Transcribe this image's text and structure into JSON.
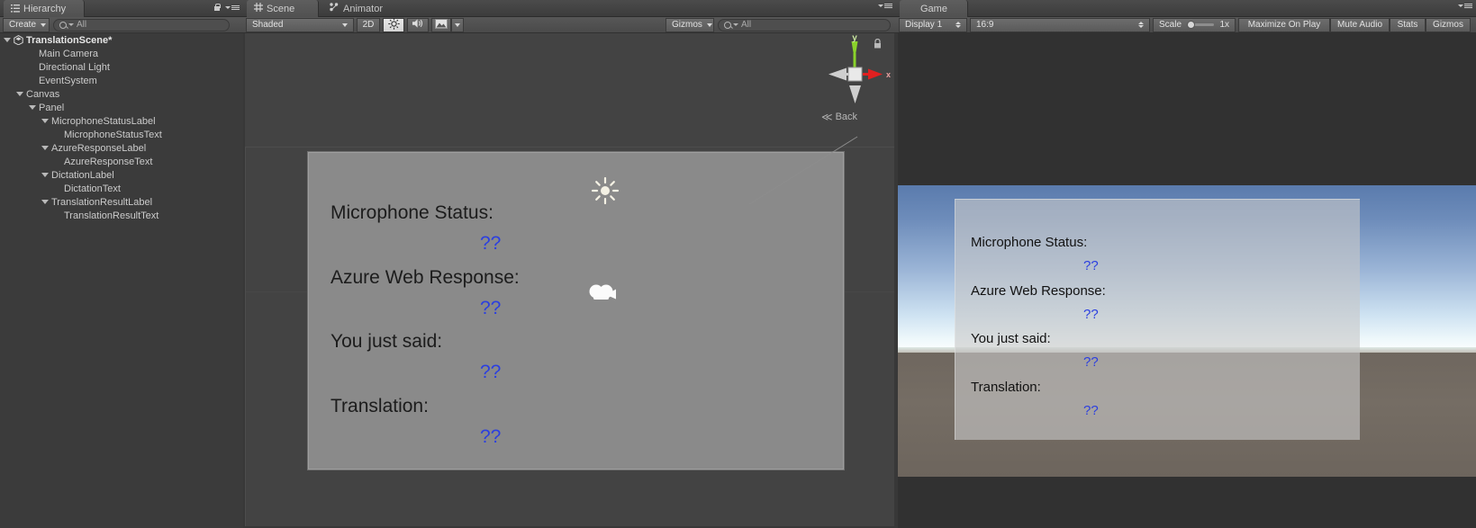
{
  "hierarchy": {
    "tab_label": "Hierarchy",
    "tab_icon": "hierarchy-icon",
    "create_label": "Create",
    "search_placeholder": "All",
    "search_value": "",
    "lock_icon": "lock-icon",
    "menu_icon": "panel-menu-icon",
    "tree": [
      {
        "label": "TranslationScene*",
        "depth": 0,
        "expanded": true,
        "root": true,
        "icon": "unity-scene-icon"
      },
      {
        "label": "Main Camera",
        "depth": 2,
        "expanded": false,
        "root": false
      },
      {
        "label": "Directional Light",
        "depth": 2,
        "expanded": false,
        "root": false
      },
      {
        "label": "EventSystem",
        "depth": 2,
        "expanded": false,
        "root": false
      },
      {
        "label": "Canvas",
        "depth": 1,
        "expanded": true,
        "root": false
      },
      {
        "label": "Panel",
        "depth": 2,
        "expanded": true,
        "root": false
      },
      {
        "label": "MicrophoneStatusLabel",
        "depth": 3,
        "expanded": true,
        "root": false
      },
      {
        "label": "MicrophoneStatusText",
        "depth": 4,
        "expanded": false,
        "root": false
      },
      {
        "label": "AzureResponseLabel",
        "depth": 3,
        "expanded": true,
        "root": false
      },
      {
        "label": "AzureResponseText",
        "depth": 4,
        "expanded": false,
        "root": false
      },
      {
        "label": "DictationLabel",
        "depth": 3,
        "expanded": true,
        "root": false
      },
      {
        "label": "DictationText",
        "depth": 4,
        "expanded": false,
        "root": false
      },
      {
        "label": "TranslationResultLabel",
        "depth": 3,
        "expanded": true,
        "root": false
      },
      {
        "label": "TranslationResultText",
        "depth": 4,
        "expanded": false,
        "root": false
      }
    ]
  },
  "scene": {
    "tabs": [
      {
        "label": "Scene",
        "icon": "scene-grid-icon",
        "active": true
      },
      {
        "label": "Animator",
        "icon": "animator-icon",
        "active": false
      }
    ],
    "toolbar": {
      "draw_mode": "Shaded",
      "two_d_label": "2D",
      "lighting_icon": "sun-icon",
      "audio_icon": "speaker-icon",
      "effects_icon": "image-icon",
      "gizmos_label": "Gizmos",
      "search_placeholder": "All",
      "search_value": ""
    },
    "gizmo": {
      "y_axis_label": "y",
      "x_axis_label": "x",
      "view_label": "Back",
      "persp_toggle": "persp-ortho-toggle",
      "x_axis_color": "#e02020",
      "y_axis_color": "#8ad32b",
      "z_axis_color": "#cccccc"
    },
    "lock_icon": "lock-icon",
    "ui_rows": [
      {
        "label": "Microphone Status:",
        "value": "??"
      },
      {
        "label": "Azure Web Response:",
        "value": "??"
      },
      {
        "label": "You just said:",
        "value": "??"
      },
      {
        "label": "Translation:",
        "value": "??"
      }
    ],
    "gizmos": [
      {
        "name": "directional-light-gizmo",
        "icon": "sun-icon"
      },
      {
        "name": "main-camera-gizmo",
        "icon": "movie-camera-icon"
      }
    ]
  },
  "game": {
    "tab_label": "Game",
    "tab_icon": "game-icon",
    "toolbar": {
      "display_label": "Display 1",
      "aspect_label": "16:9",
      "scale_label": "Scale",
      "scale_value": "1x",
      "maximize_label": "Maximize On Play",
      "mute_label": "Mute Audio",
      "stats_label": "Stats",
      "gizmos_label": "Gizmos"
    },
    "ui_rows": [
      {
        "label": "Microphone Status:",
        "value": "??"
      },
      {
        "label": "Azure Web Response:",
        "value": "??"
      },
      {
        "label": "You just said:",
        "value": "??"
      },
      {
        "label": "Translation:",
        "value": "??"
      }
    ]
  },
  "colors": {
    "chrome": "#383838",
    "panel_bg": "#3b3b3b",
    "scene_bg": "#434343",
    "ui_label": "#1c1c1c",
    "ui_value": "#2b3fe0",
    "sky_top": "#5a7bad",
    "sky_horizon": "#ffffff",
    "ground": "#6f675f"
  }
}
